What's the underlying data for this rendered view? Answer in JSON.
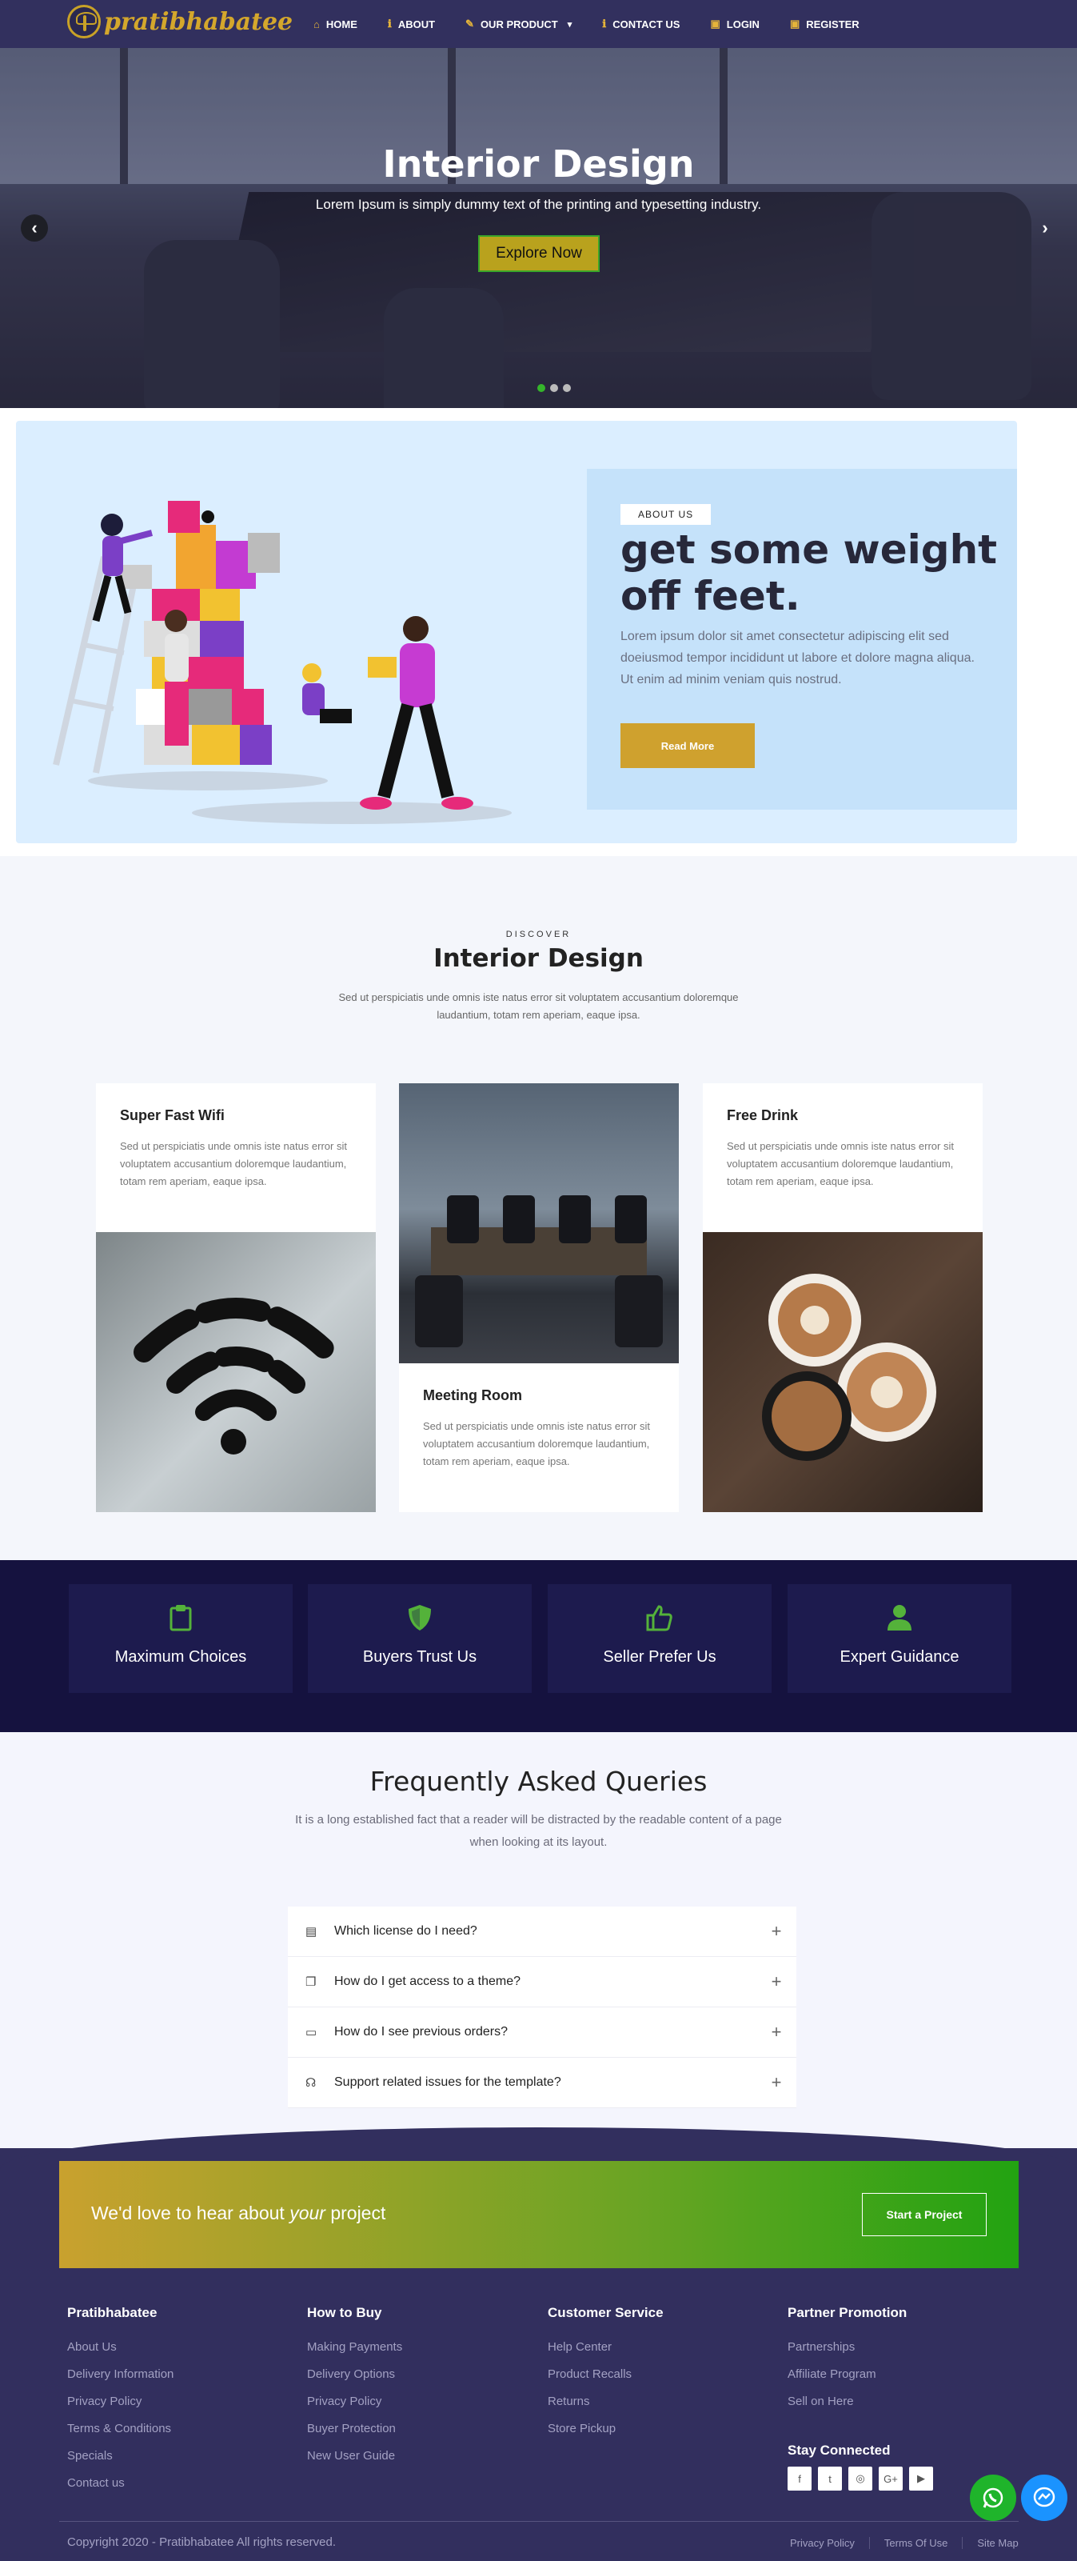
{
  "brand": {
    "name": "pratibhabatee"
  },
  "nav": {
    "items": [
      {
        "label": "HOME",
        "icon": "home-icon"
      },
      {
        "label": "ABOUT",
        "icon": "info-icon"
      },
      {
        "label": "OUR PRODUCT",
        "icon": "pencil-icon",
        "dropdown": true
      },
      {
        "label": "CONTACT US",
        "icon": "info-icon"
      },
      {
        "label": "LOGIN",
        "icon": "lock-icon"
      },
      {
        "label": "REGISTER",
        "icon": "lock-icon"
      }
    ]
  },
  "hero": {
    "title": "Interior Design",
    "subtitle": "Lorem Ipsum is simply dummy text of the printing and typesetting industry.",
    "button": "Explore Now",
    "slides": 3,
    "active_slide": 1
  },
  "about": {
    "badge": "ABOUT US",
    "title": "get some weight off feet.",
    "text": "Lorem ipsum dolor sit amet consectetur adipiscing elit sed doeiusmod tempor incididunt ut labore et dolore magna aliqua. Ut enim ad minim veniam quis nostrud.",
    "button": "Read More"
  },
  "discover": {
    "eyebrow": "DISCOVER",
    "title": "Interior Design",
    "text": "Sed ut perspiciatis unde omnis iste natus error sit voluptatem accusantium doloremque laudantium, totam rem aperiam, eaque ipsa.",
    "cards": [
      {
        "title": "Super Fast Wifi",
        "text": "Sed ut perspiciatis unde omnis iste natus error sit voluptatem accusantium doloremque laudantium, totam rem aperiam, eaque ipsa."
      },
      {
        "title": "Meeting Room",
        "text": "Sed ut perspiciatis unde omnis iste natus error sit voluptatem accusantium doloremque laudantium, totam rem aperiam, eaque ipsa."
      },
      {
        "title": "Free Drink",
        "text": "Sed ut perspiciatis unde omnis iste natus error sit voluptatem accusantium doloremque laudantium, totam rem aperiam, eaque ipsa."
      }
    ]
  },
  "features": [
    {
      "label": "Maximum Choices",
      "icon": "clipboard-icon"
    },
    {
      "label": "Buyers Trust Us",
      "icon": "shield-icon"
    },
    {
      "label": "Seller Prefer Us",
      "icon": "thumbs-up-icon"
    },
    {
      "label": "Expert Guidance",
      "icon": "user-icon"
    }
  ],
  "faq": {
    "title": "Frequently Asked Queries",
    "text": "It is a long established fact that a reader will be distracted by the readable content of a page when looking at its layout.",
    "items": [
      {
        "q": "Which license do I need?",
        "icon": "document-icon"
      },
      {
        "q": "How do I get access to a theme?",
        "icon": "copy-icon"
      },
      {
        "q": "How do I see previous orders?",
        "icon": "card-icon"
      },
      {
        "q": "Support related issues for the template?",
        "icon": "headset-icon"
      }
    ]
  },
  "cta": {
    "text_pre": "We'd love to hear about ",
    "text_em": "your",
    "text_post": " project",
    "button": "Start a Project"
  },
  "footer": {
    "cols": [
      {
        "title": "Pratibhabatee",
        "links": [
          "About Us",
          "Delivery Information",
          "Privacy Policy",
          "Terms & Conditions",
          "Specials",
          "Contact us"
        ]
      },
      {
        "title": "How to Buy",
        "links": [
          "Making Payments",
          "Delivery Options",
          "Privacy Policy",
          "Buyer Protection",
          "New User Guide"
        ]
      },
      {
        "title": "Customer Service",
        "links": [
          "Help Center",
          "Product Recalls",
          "Returns",
          "Store Pickup"
        ]
      },
      {
        "title": "Partner Promotion",
        "links": [
          "Partnerships",
          "Affiliate Program",
          "Sell on Here"
        ]
      }
    ],
    "stay_connected": "Stay Connected",
    "social": [
      {
        "label": "f",
        "icon": "facebook-icon"
      },
      {
        "label": "t",
        "icon": "twitter-icon"
      },
      {
        "label": "◎",
        "icon": "instagram-icon"
      },
      {
        "label": "G+",
        "icon": "google-plus-icon"
      },
      {
        "label": "▶",
        "icon": "youtube-icon"
      }
    ],
    "copyright": "Copyright 2020 - Pratibhabatee All rights reserved.",
    "bottom_links": [
      "Privacy Policy",
      "Terms Of Use",
      "Site Map"
    ]
  },
  "colors": {
    "nav": "#32305e",
    "accent_gold": "#cfa12e",
    "accent_green": "#35b52b",
    "features_bg": "#15123f"
  }
}
